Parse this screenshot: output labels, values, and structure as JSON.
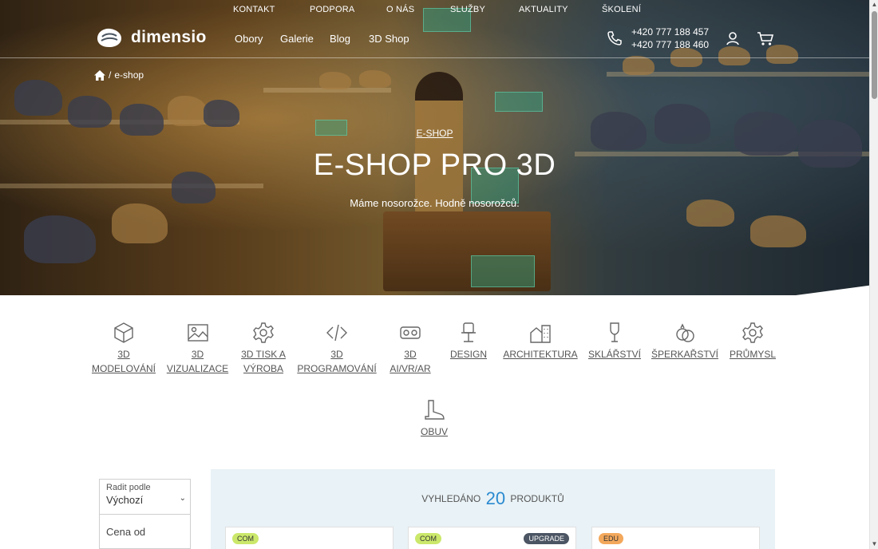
{
  "topnav": {
    "items": [
      "KONTAKT",
      "PODPORA",
      "O NÁS",
      "SLUŽBY",
      "AKTUALITY",
      "ŠKOLENÍ"
    ]
  },
  "brand": {
    "name": "dimensio"
  },
  "mainnav": {
    "items": [
      "Obory",
      "Galerie",
      "Blog",
      "3D Shop"
    ]
  },
  "contact": {
    "phone1": "+420 777 188 457",
    "phone2": "+420 777 188 460"
  },
  "breadcrumb": {
    "separator": "/",
    "current": "e-shop"
  },
  "hero": {
    "eyebrow": "E-SHOP",
    "title": "E-SHOP PRO 3D",
    "subtitle": "Máme nosorožce. Hodně nosorožců."
  },
  "categories": [
    {
      "line1": "3D",
      "line2": "MODELOVÁNÍ",
      "icon": "cube-icon"
    },
    {
      "line1": "3D",
      "line2": "VIZUALIZACE",
      "icon": "image-icon"
    },
    {
      "line1": "3D TISK A",
      "line2": "VÝROBA",
      "icon": "gear-icon"
    },
    {
      "line1": "3D",
      "line2": "PROGRAMOVÁNÍ",
      "icon": "code-icon"
    },
    {
      "line1": "3D",
      "line2": "AI/VR/AR",
      "icon": "vr-headset-icon"
    },
    {
      "line1": "DESIGN",
      "line2": "",
      "icon": "chair-icon"
    },
    {
      "line1": "ARCHITEKTURA",
      "line2": "",
      "icon": "buildings-icon"
    },
    {
      "line1": "SKLÁŘSTVÍ",
      "line2": "",
      "icon": "wine-glass-icon"
    },
    {
      "line1": "ŠPERKAŘSTVÍ",
      "line2": "",
      "icon": "rings-icon"
    },
    {
      "line1": "PRŮMYSL",
      "line2": "",
      "icon": "gear-icon"
    },
    {
      "line1": "OBUV",
      "line2": "",
      "icon": "boot-icon"
    }
  ],
  "filters": {
    "sort_label": "Radit podle",
    "sort_value": "Výchozí",
    "price_from_placeholder": "Cena od"
  },
  "results": {
    "prefix": "VYHLEDÁNO",
    "count": "20",
    "suffix": "PRODUKTŮ"
  },
  "cards": [
    {
      "badge": "COM"
    },
    {
      "badge": "COM",
      "badge2": "UPGRADE"
    },
    {
      "badge": "EDU"
    }
  ]
}
